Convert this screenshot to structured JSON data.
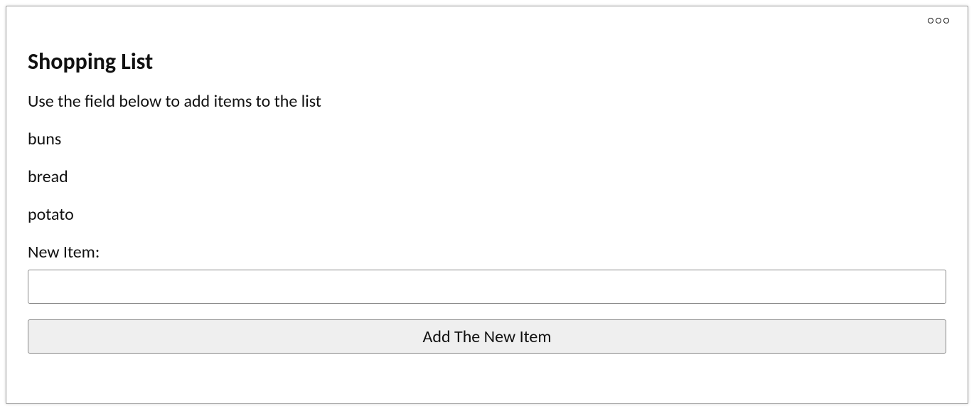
{
  "card": {
    "title": "Shopping List",
    "subtitle": "Use the field below to add items to the list",
    "items": [
      "buns",
      "bread",
      "potato"
    ],
    "newItemLabel": "New Item:",
    "newItemValue": "",
    "addButtonLabel": "Add The New Item"
  }
}
